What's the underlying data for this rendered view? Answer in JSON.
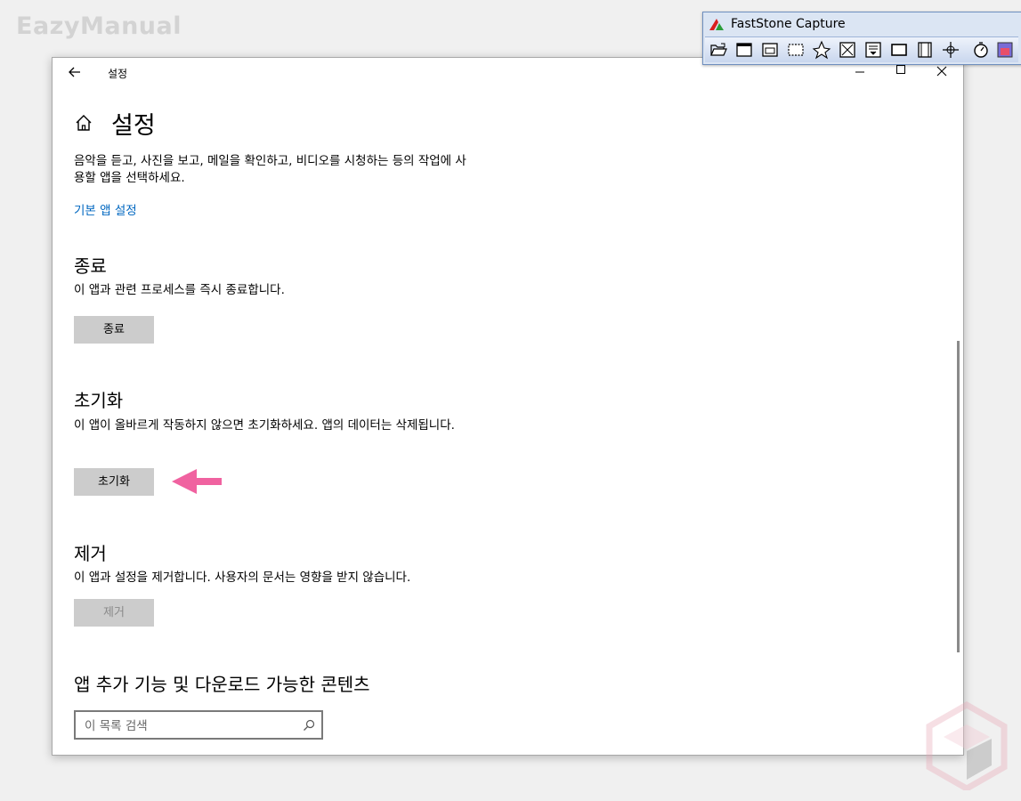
{
  "watermark": "EazyManual",
  "window": {
    "title": "설정",
    "back_icon": "back-arrow-icon",
    "minimize": "—",
    "maximize": "☐",
    "close": "✕"
  },
  "page": {
    "title": "설정",
    "home_icon": "home-icon",
    "description": "음악을 듣고, 사진을 보고, 메일을 확인하고, 비디오를 시청하는 등의 작업에 사용할 앱을 선택하세요.",
    "default_apps_link": "기본 앱 설정"
  },
  "terminate": {
    "title": "종료",
    "description": "이 앱과 관련 프로세스를 즉시 종료합니다.",
    "button": "종료"
  },
  "reset": {
    "title": "초기화",
    "description": "이 앱이 올바르게 작동하지 않으면 초기화하세요. 앱의 데이터는 삭제됩니다.",
    "button": "초기화"
  },
  "uninstall": {
    "title": "제거",
    "description": "이 앱과 설정을 제거합니다. 사용자의 문서는 영향을 받지 않습니다.",
    "button": "제거"
  },
  "addons": {
    "title": "앱 추가 기능 및 다운로드 가능한 콘텐츠",
    "search_placeholder": "이 목록 검색"
  },
  "faststone": {
    "title": "FastStone Capture",
    "tools": [
      "open-icon",
      "window-capture-icon",
      "object-capture-icon",
      "rect-capture-icon",
      "freehand-capture-icon",
      "fullscreen-capture-icon",
      "scroll-capture-icon",
      "fixed-region-icon",
      "video-record-icon",
      "crosshair-icon",
      "timer-icon",
      "output-icon"
    ]
  },
  "colors": {
    "accent_link": "#0067c0",
    "arrow": "#f062a0",
    "button_bg": "#cccccc"
  }
}
